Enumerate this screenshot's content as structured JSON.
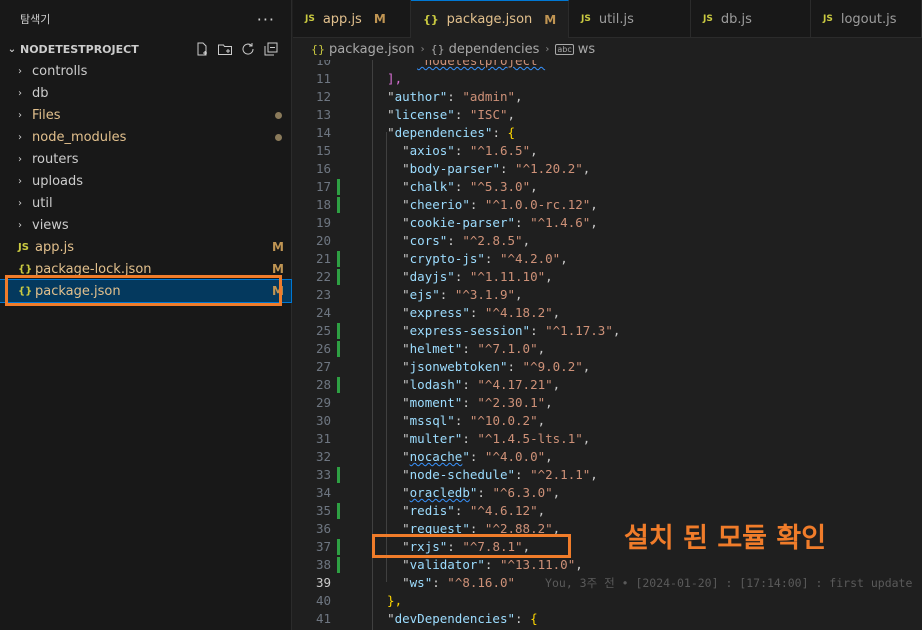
{
  "sidebar": {
    "title": "탐색기",
    "more": "···",
    "project": "NODETESTPROJECT",
    "items": [
      {
        "name": "controlls",
        "type": "folder"
      },
      {
        "name": "db",
        "type": "folder"
      },
      {
        "name": "Files",
        "type": "folder",
        "dot": true
      },
      {
        "name": "node_modules",
        "type": "folder",
        "dot": true
      },
      {
        "name": "routers",
        "type": "folder"
      },
      {
        "name": "uploads",
        "type": "folder"
      },
      {
        "name": "util",
        "type": "folder"
      },
      {
        "name": "views",
        "type": "folder"
      },
      {
        "name": "app.js",
        "type": "js",
        "badge": "M"
      },
      {
        "name": "package-lock.json",
        "type": "json",
        "badge": "M"
      },
      {
        "name": "package.json",
        "type": "json",
        "badge": "M"
      }
    ],
    "icons": {
      "js": "JS",
      "json": "{}"
    }
  },
  "tabs": [
    {
      "icon": "JS",
      "label": "app.js",
      "badge": "M"
    },
    {
      "icon": "{}",
      "label": "package.json",
      "badge": "M",
      "active": true
    },
    {
      "icon": "JS",
      "label": "util.js"
    },
    {
      "icon": "JS",
      "label": "db.js"
    },
    {
      "icon": "JS",
      "label": "logout.js"
    }
  ],
  "breadcrumb": {
    "file": "package.json",
    "section": "dependencies",
    "leaf": "ws",
    "file_icon": "{}",
    "section_icon": "{}",
    "leaf_icon": "abc"
  },
  "editor": {
    "lines": [
      {
        "n": "10",
        "pre": "      ",
        "s": "\"nodetestproject\"",
        "clip": true
      },
      {
        "n": "11",
        "raw": "  ],",
        "brk": true
      },
      {
        "n": "12",
        "k": "author",
        "v": "admin"
      },
      {
        "n": "13",
        "k": "license",
        "v": "ISC"
      },
      {
        "n": "14",
        "k": "dependencies",
        "open": true
      },
      {
        "n": "15",
        "k": "axios",
        "v": "^1.6.5",
        "d": 2
      },
      {
        "n": "16",
        "k": "body-parser",
        "v": "^1.20.2",
        "d": 2
      },
      {
        "n": "17",
        "k": "chalk",
        "v": "^5.3.0",
        "d": 2,
        "g": true
      },
      {
        "n": "18",
        "k": "cheerio",
        "v": "^1.0.0-rc.12",
        "d": 2,
        "g": true
      },
      {
        "n": "19",
        "k": "cookie-parser",
        "v": "^1.4.6",
        "d": 2
      },
      {
        "n": "20",
        "k": "cors",
        "v": "^2.8.5",
        "d": 2
      },
      {
        "n": "21",
        "k": "crypto-js",
        "v": "^4.2.0",
        "d": 2,
        "g": true
      },
      {
        "n": "22",
        "k": "dayjs",
        "v": "^1.11.10",
        "d": 2,
        "g": true
      },
      {
        "n": "23",
        "k": "ejs",
        "v": "^3.1.9",
        "d": 2
      },
      {
        "n": "24",
        "k": "express",
        "v": "^4.18.2",
        "d": 2
      },
      {
        "n": "25",
        "k": "express-session",
        "v": "^1.17.3",
        "d": 2,
        "g": true
      },
      {
        "n": "26",
        "k": "helmet",
        "v": "^7.1.0",
        "d": 2,
        "g": true
      },
      {
        "n": "27",
        "k": "jsonwebtoken",
        "v": "^9.0.2",
        "d": 2
      },
      {
        "n": "28",
        "k": "lodash",
        "v": "^4.17.21",
        "d": 2,
        "g": true
      },
      {
        "n": "29",
        "k": "moment",
        "v": "^2.30.1",
        "d": 2
      },
      {
        "n": "30",
        "k": "mssql",
        "v": "^10.0.2",
        "d": 2
      },
      {
        "n": "31",
        "k": "multer",
        "v": "^1.4.5-lts.1",
        "d": 2
      },
      {
        "n": "32",
        "k": "nocache",
        "v": "^4.0.0",
        "d": 2,
        "sq": true
      },
      {
        "n": "33",
        "k": "node-schedule",
        "v": "^2.1.1",
        "d": 2,
        "g": true
      },
      {
        "n": "34",
        "k": "oracledb",
        "v": "^6.3.0",
        "d": 2,
        "sq": true
      },
      {
        "n": "35",
        "k": "redis",
        "v": "^4.6.12",
        "d": 2,
        "g": true
      },
      {
        "n": "36",
        "k": "request",
        "v": "^2.88.2",
        "d": 2
      },
      {
        "n": "37",
        "k": "rxjs",
        "v": "^7.8.1",
        "d": 2,
        "g": true
      },
      {
        "n": "38",
        "k": "validator",
        "v": "^13.11.0",
        "d": 2,
        "g": true
      },
      {
        "n": "39",
        "k": "ws",
        "v": "^8.16.0",
        "d": 2,
        "last": true,
        "current": true,
        "blame": "You, 3주 전 • [2024-01-20] : [17:14:00] : first update"
      },
      {
        "n": "40",
        "raw": "  },",
        "brc": true
      },
      {
        "n": "41",
        "k": "devDependencies",
        "open": true
      }
    ]
  },
  "annotation": "설치 된 모듈 확인",
  "colors": {
    "highlight": "#f07c2a",
    "git_added": "#2ea043",
    "selection": "#04395e"
  }
}
